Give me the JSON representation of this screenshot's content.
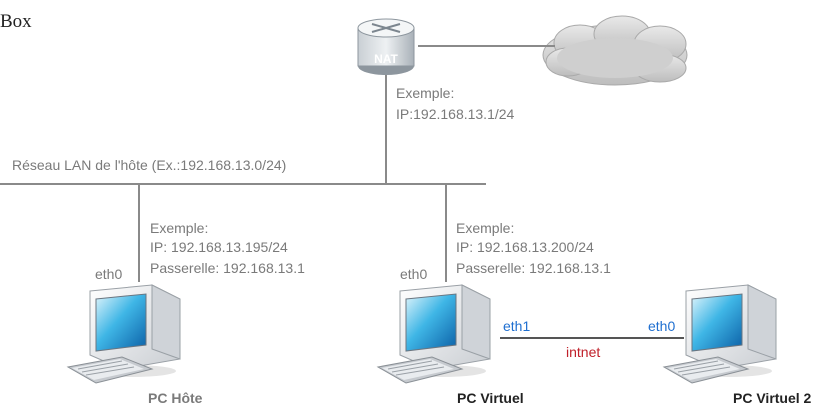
{
  "title_fragment": "Box",
  "router": {
    "label": "NAT"
  },
  "nat_info": {
    "line1": "Exemple:",
    "line2": "IP:192.168.13.1/24"
  },
  "lan": {
    "label": "Réseau LAN de l'hôte (Ex.:192.168.13.0/24)"
  },
  "host_info": {
    "line1": "Exemple:",
    "line2": "IP: 192.168.13.195/24",
    "line3": "Passerelle: 192.168.13.1"
  },
  "vm_info": {
    "line1": "Exemple:",
    "line2": "IP: 192.168.13.200/24",
    "line3": "Passerelle: 192.168.13.1"
  },
  "pc_host": {
    "iface": "eth0",
    "name": "PC Hôte"
  },
  "pc_virtual": {
    "iface_lan": "eth0",
    "iface_int": "eth1",
    "name": "PC Virtuel"
  },
  "pc_virtual2": {
    "iface": "eth0",
    "name": "PC Virtuel 2"
  },
  "internal_link": {
    "label": "intnet"
  },
  "colors": {
    "wire": "#8a8a8a",
    "interface_label": "#1f6fd0",
    "internal_network_label": "#c0202a",
    "router_body": "#9aa4ad"
  }
}
